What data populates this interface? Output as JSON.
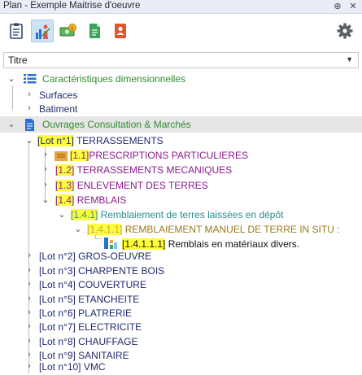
{
  "window": {
    "title": "Plan - Exemple Maitrise d'oeuvre",
    "pin_glyph": "⊕",
    "close_glyph": "✕"
  },
  "toolbar": {
    "tools": [
      {
        "name": "clipboard-checklist-icon"
      },
      {
        "name": "people-chart-icon",
        "active": true
      },
      {
        "name": "money-icon"
      },
      {
        "name": "document-green-icon"
      },
      {
        "name": "contact-card-icon"
      }
    ],
    "settings_icon": "gear-icon"
  },
  "column_header": {
    "title": "Titre",
    "dropdown_glyph": "▼"
  },
  "tree": {
    "expanded_glyph": "⌄",
    "collapsed_glyph": "›",
    "dimensional": {
      "label": "Caractéristiques dimensionnelles",
      "children": [
        "Surfaces",
        "Batiment"
      ]
    },
    "works": {
      "label": "Ouvrages Consultation & Marchés",
      "lot1": {
        "code": "[Lot n°1]",
        "label": "TERRASSEMENTS",
        "items": [
          {
            "code": "[1.1]",
            "label": "PRESCRIPTIONS PARTICULIERES"
          },
          {
            "code": "[1.2]",
            "label": "TERRASSEMENTS MECANIQUES"
          },
          {
            "code": "[1.3]",
            "label": "ENLEVEMENT DES TERRES"
          },
          {
            "code": "[1.4]",
            "label": "REMBLAIS"
          }
        ],
        "sub": {
          "code": "[1.4.1]",
          "label": "Remblaiement de terres laissées en dépôt"
        },
        "subsub": {
          "code": "[1.4.1.1]",
          "label": "REMBLAIEMENT MANUEL DE TERRE IN SITU :"
        },
        "leaf": {
          "code": "[1.4.1.1.1]",
          "label": "Remblais en matériaux divers."
        }
      },
      "other_lots": [
        "[Lot n°2] GROS-OEUVRE",
        "[Lot n°3] CHARPENTE BOIS",
        "[Lot n°4] COUVERTURE",
        "[Lot n°5] ETANCHEITE",
        "[Lot n°6] PLATRERIE",
        "[Lot n°7] ELECTRICITE",
        "[Lot n°8] CHAUFFAGE",
        "[Lot n°9] SANITAIRE",
        "[Lot n°10] VMC"
      ]
    }
  },
  "colors": {
    "highlight": "#ffff3c",
    "green": "#2e8b2e",
    "purple": "#8b1a8b",
    "teal": "#2a8d8d",
    "olive": "#9b7a1a",
    "navy": "#1f2a6b"
  }
}
